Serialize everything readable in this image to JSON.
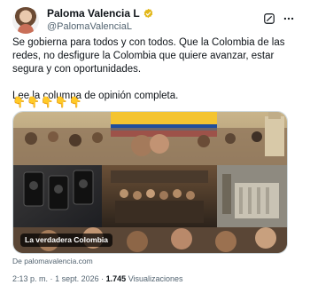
{
  "author": {
    "name": "Paloma Valencia L",
    "handle": "@PalomaValenciaL"
  },
  "tweet": {
    "paragraph1": "Se gobierna para todos y con todos. Que la Colombia de las redes, no desfigure la Colombia que quiere avanzar, estar segura y con oportunidades.",
    "paragraph2": "Lee la columna de opinión completa.",
    "emoji": "👇👇👇👇👇"
  },
  "media": {
    "caption": "La verdadera Colombia",
    "source": "De palomavalencia.com"
  },
  "meta": {
    "time": "2:13 p. m.",
    "separator1": "·",
    "date": "1 sept. 2026",
    "separator2": "·",
    "views_count": "1.745",
    "views_label": "Visualizaciones"
  },
  "icons": {
    "verified": "verified-check-icon",
    "grok": "grok-icon",
    "more": "more-options-icon"
  },
  "colors": {
    "verified_gold": "#e2b719",
    "secondary_text": "#536471",
    "flag_yellow": "#f4c430",
    "flag_blue": "#1f4e9c",
    "flag_red": "#c8102e"
  }
}
